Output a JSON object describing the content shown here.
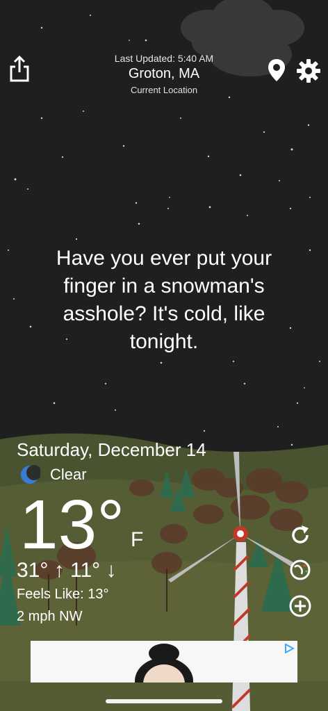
{
  "header": {
    "last_updated": "Last Updated: 5:40 AM",
    "city": "Groton, MA",
    "location_label": "Current Location"
  },
  "icons": {
    "share": "share-icon",
    "location": "map-pin-icon",
    "settings": "gear-icon",
    "condition": "moon-icon",
    "refresh": "refresh-icon",
    "theme": "globe-icon",
    "add": "plus-circle-icon"
  },
  "quote": "Have you ever put your finger in a snowman's asshole? It's cold, like tonight.",
  "weather": {
    "date": "Saturday, December 14",
    "condition": "Clear",
    "temperature": "13°",
    "unit": "F",
    "high_low": "31° ↑  11° ↓",
    "feels_like": "Feels Like: 13°",
    "wind": "2 mph NW"
  },
  "colors": {
    "sky": "#1f1f20",
    "hill_far": "#4d5630",
    "hill_near": "#5c6135",
    "accent_blue": "#3a7bd5"
  }
}
